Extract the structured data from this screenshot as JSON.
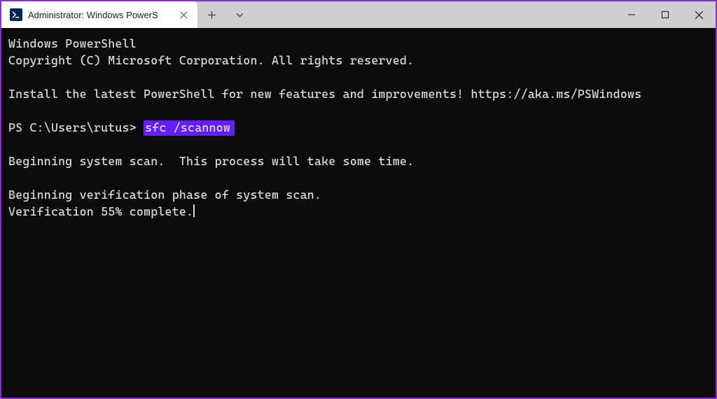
{
  "colors": {
    "windowBorder": "#8c2fd1",
    "highlight": "#651fff",
    "terminalBg": "#0c0c0c",
    "terminalFg": "#d9d9d9",
    "titlebarBg": "#cfcfcf",
    "tabBg": "#ffffff"
  },
  "titlebar": {
    "tab": {
      "title": "Administrator: Windows PowerS",
      "icon": "powershell-icon"
    },
    "buttons": {
      "newTab": "+",
      "dropdown": "⌄"
    }
  },
  "terminal": {
    "header1": "Windows PowerShell",
    "header2": "Copyright (C) Microsoft Corporation. All rights reserved.",
    "installMsg": "Install the latest PowerShell for new features and improvements! https://aka.ms/PSWindows",
    "promptPrefix": "PS C:\\Users\\rutus> ",
    "command": "sfc /scannow",
    "output1": "Beginning system scan.  This process will take some time.",
    "output2": "Beginning verification phase of system scan.",
    "output3": "Verification 55% complete."
  }
}
